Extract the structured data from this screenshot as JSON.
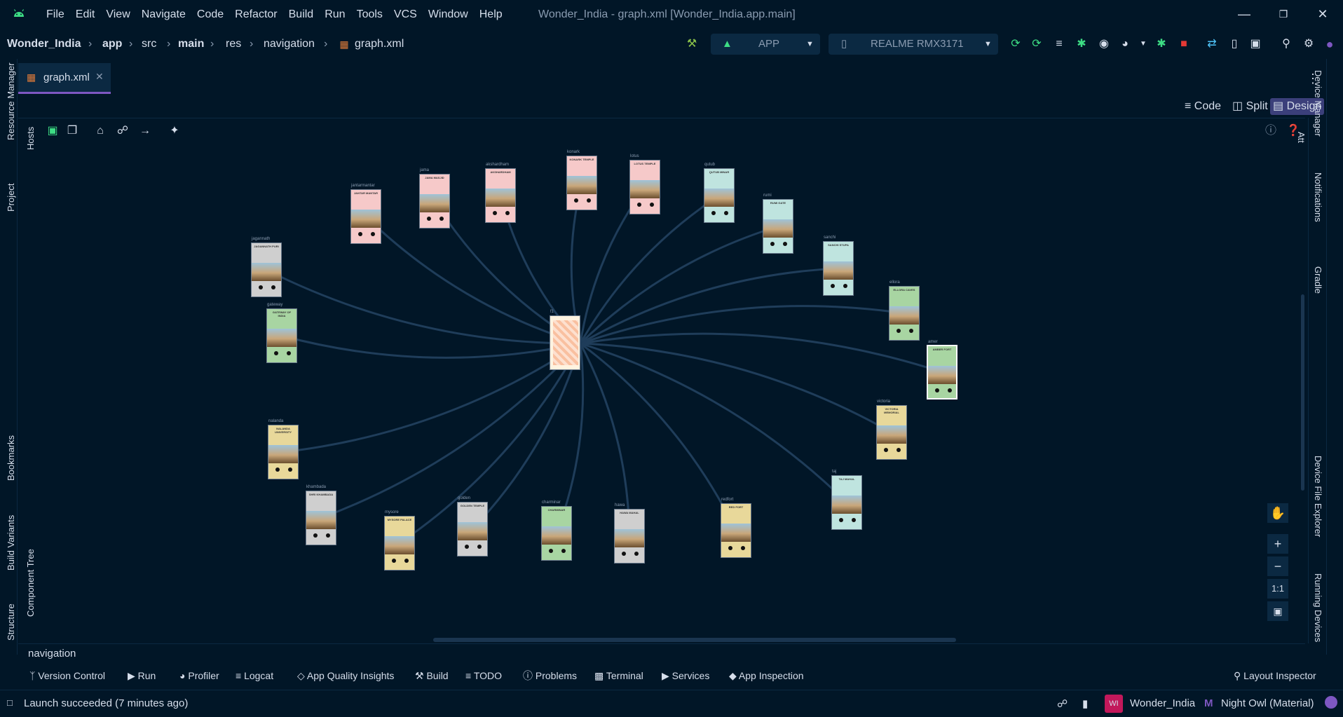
{
  "menu": [
    "File",
    "Edit",
    "View",
    "Navigate",
    "Code",
    "Refactor",
    "Build",
    "Run",
    "Tools",
    "VCS",
    "Window",
    "Help"
  ],
  "window_title": "Wonder_India - graph.xml [Wonder_India.app.main]",
  "breadcrumb": [
    "Wonder_India",
    "app",
    "src",
    "main",
    "res",
    "navigation",
    "graph.xml"
  ],
  "run_config": "APP",
  "device": "REALME RMX3171",
  "editor_tab": "graph.xml",
  "view_modes": {
    "code": "Code",
    "split": "Split",
    "design": "Design"
  },
  "left_strip": [
    "Resource Manager",
    "Project",
    "Bookmarks",
    "Build Variants",
    "Structure"
  ],
  "left_panel": [
    "Hosts",
    "Component Tree"
  ],
  "right_strip": [
    "Device Manager",
    "Notifications",
    "Gradle",
    "Device File Explorer",
    "Running Devices"
  ],
  "right_panel": [
    "Attributes"
  ],
  "graph": {
    "start_label": "f1",
    "destinations": [
      {
        "id": "gateway",
        "title": "GATEWAY OF INDIA",
        "color": "#a8d5a2"
      },
      {
        "id": "jagannath",
        "title": "JAGANNATH PURI",
        "color": "#cfcfcf"
      },
      {
        "id": "jantarmantar",
        "title": "JANTAR MANTAR",
        "color": "#f6c9c9"
      },
      {
        "id": "jama",
        "title": "JAMA MASJID",
        "color": "#f6c9c9"
      },
      {
        "id": "akshardham",
        "title": "AKSHARDHAM",
        "color": "#f6c9c9"
      },
      {
        "id": "konark",
        "title": "KONARK TEMPLE",
        "color": "#f6c9c9"
      },
      {
        "id": "lotus",
        "title": "LOTUS TEMPLE",
        "color": "#f6c9c9"
      },
      {
        "id": "qutub",
        "title": "QUTUB MINAR",
        "color": "#bfe4df"
      },
      {
        "id": "rumi",
        "title": "RUMI GATE",
        "color": "#bfe4df"
      },
      {
        "id": "sanchi",
        "title": "SANCHI STUPA",
        "color": "#bfe4df"
      },
      {
        "id": "ellora",
        "title": "ELLORA CAVES",
        "color": "#a8d5a2"
      },
      {
        "id": "amer",
        "title": "AMBER FORT",
        "color": "#a8d5a2"
      },
      {
        "id": "victoria",
        "title": "VICTORIA MEMORIAL",
        "color": "#e8d89a"
      },
      {
        "id": "taj",
        "title": "TAJ MAHAL",
        "color": "#bfe4df"
      },
      {
        "id": "redfort",
        "title": "RED FORT",
        "color": "#e8d89a"
      },
      {
        "id": "hawa",
        "title": "HAWA MAHAL",
        "color": "#cfcfcf"
      },
      {
        "id": "charminar",
        "title": "CHARMINAR",
        "color": "#a8d5a2"
      },
      {
        "id": "golden",
        "title": "GOLDEN TEMPLE",
        "color": "#cfcfcf"
      },
      {
        "id": "mysore",
        "title": "MYSORE PALACE",
        "color": "#e8d89a"
      },
      {
        "id": "khambada",
        "title": "SHRI KHAMBADA",
        "color": "#cfcfcf"
      },
      {
        "id": "nalanda",
        "title": "NALANDA UNIVERSITY",
        "color": "#e8d89a"
      }
    ]
  },
  "bottom_crumb": "navigation",
  "tool_windows": [
    "Version Control",
    "Run",
    "Profiler",
    "Logcat",
    "App Quality Insights",
    "Build",
    "TODO",
    "Problems",
    "Terminal",
    "Services",
    "App Inspection"
  ],
  "layout_inspector": "Layout Inspector",
  "status": "Launch succeeded (7 minutes ago)",
  "project_badge": "WI",
  "project_name": "Wonder_India",
  "theme_name": "Night Owl (Material)",
  "zoom_controls": {
    "one_to_one": "1:1"
  }
}
